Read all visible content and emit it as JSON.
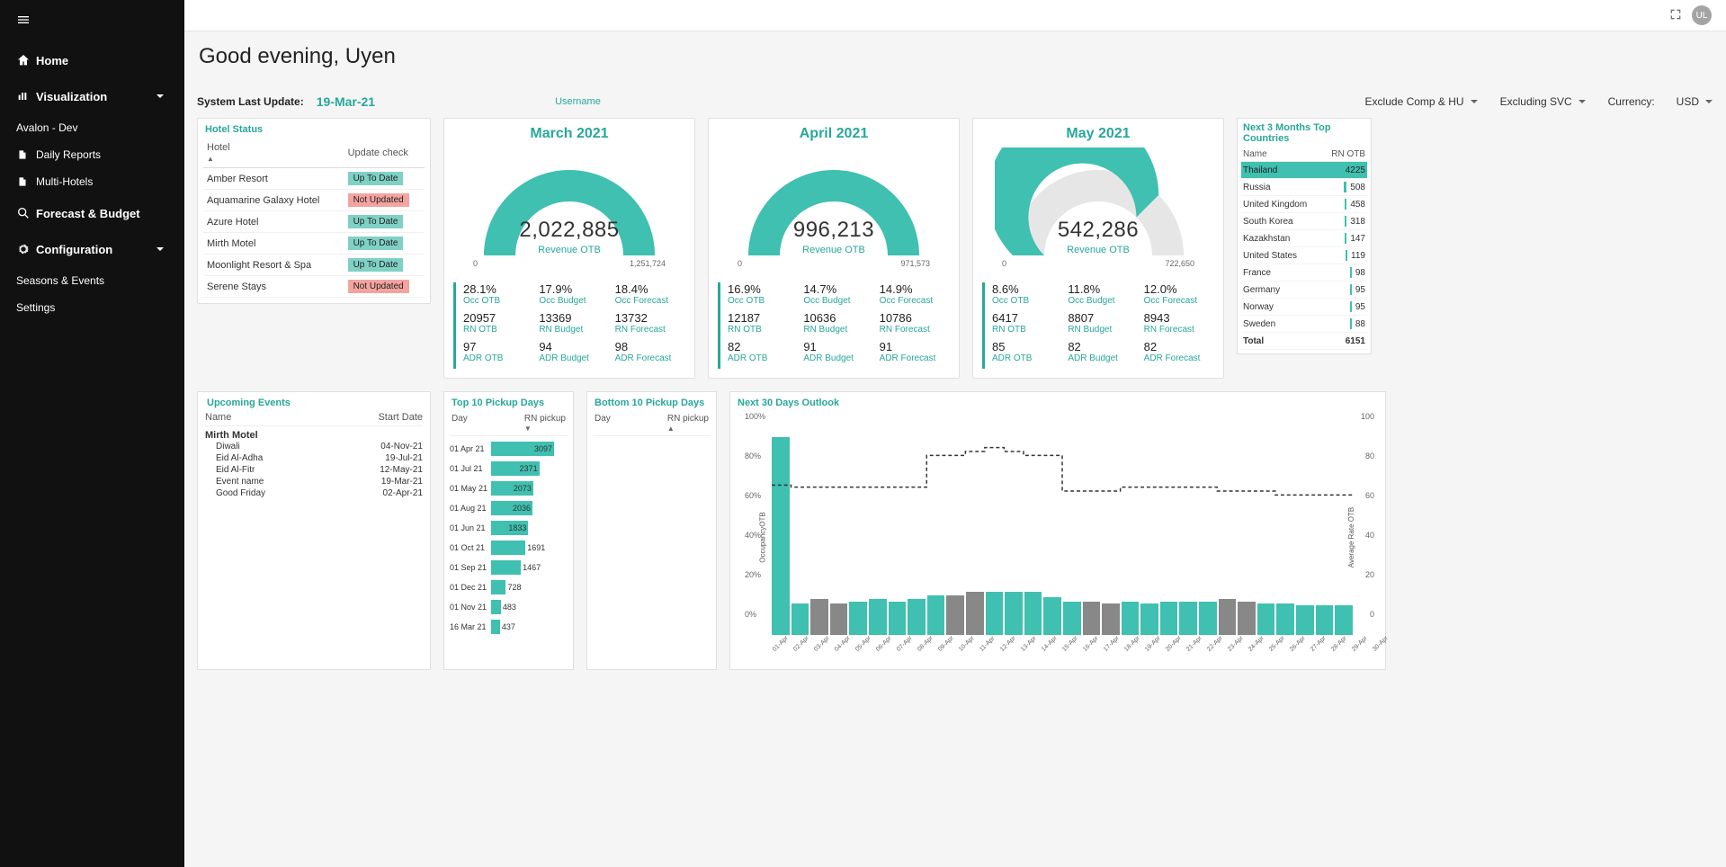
{
  "sidebar": {
    "items": [
      {
        "icon": "home",
        "label": "Home"
      },
      {
        "icon": "bars",
        "label": "Visualization",
        "expandable": true
      },
      {
        "label": "Avalon - Dev",
        "plain": true
      },
      {
        "icon": "file",
        "label": "Daily Reports",
        "sub": true,
        "chev": true
      },
      {
        "icon": "file",
        "label": "Multi-Hotels",
        "sub": true,
        "chev": true
      },
      {
        "icon": "search-db",
        "label": "Forecast & Budget"
      },
      {
        "icon": "gear",
        "label": "Configuration",
        "expandable": true
      },
      {
        "label": "Seasons & Events",
        "plain": true
      },
      {
        "label": "Settings",
        "plain": true
      }
    ]
  },
  "header": {
    "avatar_initials": "UL"
  },
  "greeting": "Good evening, Uyen",
  "system_update": {
    "label": "System Last Update:",
    "value": "19-Mar-21"
  },
  "username_placeholder": "Username",
  "filters": {
    "comp": "Exclude Comp & HU",
    "svc": "Excluding SVC",
    "currency_label": "Currency:",
    "currency": "USD"
  },
  "hotel_status": {
    "title": "Hotel Status",
    "cols": [
      "Hotel",
      "Update check"
    ],
    "rows": [
      {
        "name": "Amber Resort",
        "status": "Up To Date",
        "cls": "up"
      },
      {
        "name": "Aquamarine Galaxy Hotel",
        "status": "Not Updated",
        "cls": "not"
      },
      {
        "name": "Azure Hotel",
        "status": "Up To Date",
        "cls": "up"
      },
      {
        "name": "Mirth Motel",
        "status": "Up To Date",
        "cls": "up"
      },
      {
        "name": "Moonlight Resort & Spa",
        "status": "Up To Date",
        "cls": "up"
      },
      {
        "name": "Serene Stays",
        "status": "Not Updated",
        "cls": "not"
      }
    ]
  },
  "months": [
    {
      "title": "March 2021",
      "revenue": "2,022,885",
      "revenue_label": "Revenue OTB",
      "min": "0",
      "max": "1,251,724",
      "fill_pct": 100,
      "metrics": {
        "c1": [
          "28.1%",
          "Occ OTB",
          "20957",
          "RN OTB",
          "97",
          "ADR OTB"
        ],
        "c2": [
          "17.9%",
          "Occ Budget",
          "13369",
          "RN Budget",
          "94",
          "ADR Budget"
        ],
        "c3": [
          "18.4%",
          "Occ Forecast",
          "13732",
          "RN Forecast",
          "98",
          "ADR Forecast"
        ]
      }
    },
    {
      "title": "April 2021",
      "revenue": "996,213",
      "revenue_label": "Revenue OTB",
      "min": "0",
      "max": "971,573",
      "fill_pct": 100,
      "metrics": {
        "c1": [
          "16.9%",
          "Occ OTB",
          "12187",
          "RN OTB",
          "82",
          "ADR OTB"
        ],
        "c2": [
          "14.7%",
          "Occ Budget",
          "10636",
          "RN Budget",
          "91",
          "ADR Budget"
        ],
        "c3": [
          "14.9%",
          "Occ Forecast",
          "10786",
          "RN Forecast",
          "91",
          "ADR Forecast"
        ]
      }
    },
    {
      "title": "May 2021",
      "revenue": "542,286",
      "revenue_label": "Revenue OTB",
      "min": "0",
      "max": "722,650",
      "fill_pct": 75,
      "metrics": {
        "c1": [
          "8.6%",
          "Occ OTB",
          "6417",
          "RN OTB",
          "85",
          "ADR OTB"
        ],
        "c2": [
          "11.8%",
          "Occ Budget",
          "8807",
          "RN Budget",
          "82",
          "ADR Budget"
        ],
        "c3": [
          "12.0%",
          "Occ Forecast",
          "8943",
          "RN Forecast",
          "82",
          "ADR Forecast"
        ]
      }
    }
  ],
  "top_countries": {
    "title": "Next 3 Months Top Countries",
    "cols": [
      "Name",
      "RN OTB"
    ],
    "rows": [
      {
        "name": "Thailand",
        "value": 4225,
        "hl": true
      },
      {
        "name": "Russia",
        "value": 508
      },
      {
        "name": "United Kingdom",
        "value": 458
      },
      {
        "name": "South Korea",
        "value": 318
      },
      {
        "name": "Kazakhstan",
        "value": 147
      },
      {
        "name": "United States",
        "value": 119
      },
      {
        "name": "France",
        "value": 98
      },
      {
        "name": "Germany",
        "value": 95
      },
      {
        "name": "Norway",
        "value": 95
      },
      {
        "name": "Sweden",
        "value": 88
      }
    ],
    "total_label": "Total",
    "total": 6151
  },
  "upcoming_events": {
    "title": "Upcoming Events",
    "cols": [
      "Name",
      "Start Date"
    ],
    "group": "Mirth Motel",
    "rows": [
      {
        "name": "Diwali",
        "date": "04-Nov-21"
      },
      {
        "name": "Eid Al-Adha",
        "date": "19-Jul-21"
      },
      {
        "name": "Eid Al-Fitr",
        "date": "12-May-21"
      },
      {
        "name": "Event name",
        "date": "19-Mar-21"
      },
      {
        "name": "Good Friday",
        "date": "02-Apr-21"
      }
    ]
  },
  "top_pickup": {
    "title": "Top 10 Pickup Days",
    "cols": [
      "Day",
      "RN pickup"
    ],
    "rows": [
      {
        "day": "01 Apr 21",
        "value": 3097
      },
      {
        "day": "01 Jul 21",
        "value": 2371
      },
      {
        "day": "01 May 21",
        "value": 2073
      },
      {
        "day": "01 Aug 21",
        "value": 2036
      },
      {
        "day": "01 Jun 21",
        "value": 1833
      },
      {
        "day": "01 Oct 21",
        "value": 1691
      },
      {
        "day": "01 Sep 21",
        "value": 1467
      },
      {
        "day": "01 Dec 21",
        "value": 728
      },
      {
        "day": "01 Nov 21",
        "value": 483
      },
      {
        "day": "16 Mar 21",
        "value": 437
      }
    ]
  },
  "bottom_pickup": {
    "title": "Bottom 10 Pickup Days",
    "cols": [
      "Day",
      "RN pickup"
    ]
  },
  "outlook": {
    "title": "Next 30 Days Outlook",
    "y_left_label": "OccupancyOTB",
    "y_right_label": "Average Rate OTB",
    "y_left_ticks": [
      "100%",
      "80%",
      "60%",
      "40%",
      "20%",
      "0%"
    ],
    "y_right_ticks": [
      "100",
      "80",
      "60",
      "40",
      "20",
      "0"
    ]
  },
  "chart_data": {
    "type": "bar",
    "title": "Next 30 Days Outlook",
    "categories": [
      "01-Apr",
      "02-Apr",
      "03-Apr",
      "04-Apr",
      "05-Apr",
      "06-Apr",
      "07-Apr",
      "08-Apr",
      "09-Apr",
      "10-Apr",
      "11-Apr",
      "12-Apr",
      "13-Apr",
      "14-Apr",
      "15-Apr",
      "16-Apr",
      "17-Apr",
      "18-Apr",
      "19-Apr",
      "20-Apr",
      "21-Apr",
      "22-Apr",
      "23-Apr",
      "24-Apr",
      "25-Apr",
      "26-Apr",
      "27-Apr",
      "28-Apr",
      "29-Apr",
      "30-Apr"
    ],
    "series": [
      {
        "name": "OccupancyOTB",
        "axis": "left",
        "unit": "percent",
        "values": [
          100,
          16,
          18,
          16,
          17,
          18,
          17,
          18,
          20,
          20,
          22,
          22,
          22,
          22,
          19,
          17,
          17,
          16,
          17,
          16,
          17,
          17,
          17,
          18,
          17,
          16,
          16,
          15,
          15,
          15
        ],
        "colors": [
          "teal",
          "teal",
          "gray",
          "gray",
          "teal",
          "teal",
          "teal",
          "teal",
          "teal",
          "gray",
          "gray",
          "teal",
          "teal",
          "teal",
          "teal",
          "teal",
          "gray",
          "gray",
          "teal",
          "teal",
          "teal",
          "teal",
          "teal",
          "gray",
          "gray",
          "teal",
          "teal",
          "teal",
          "teal",
          "teal"
        ]
      },
      {
        "name": "Average Rate OTB",
        "axis": "right",
        "style": "dashed-step",
        "values": [
          63,
          62,
          62,
          62,
          62,
          62,
          62,
          62,
          78,
          78,
          80,
          82,
          80,
          78,
          78,
          60,
          60,
          60,
          62,
          62,
          62,
          62,
          62,
          60,
          60,
          60,
          58,
          58,
          58,
          58
        ]
      }
    ],
    "y_axis_left": {
      "label": "OccupancyOTB",
      "range": [
        0,
        100
      ],
      "unit": "%"
    },
    "y_axis_right": {
      "label": "Average Rate OTB",
      "range": [
        0,
        100
      ]
    }
  }
}
